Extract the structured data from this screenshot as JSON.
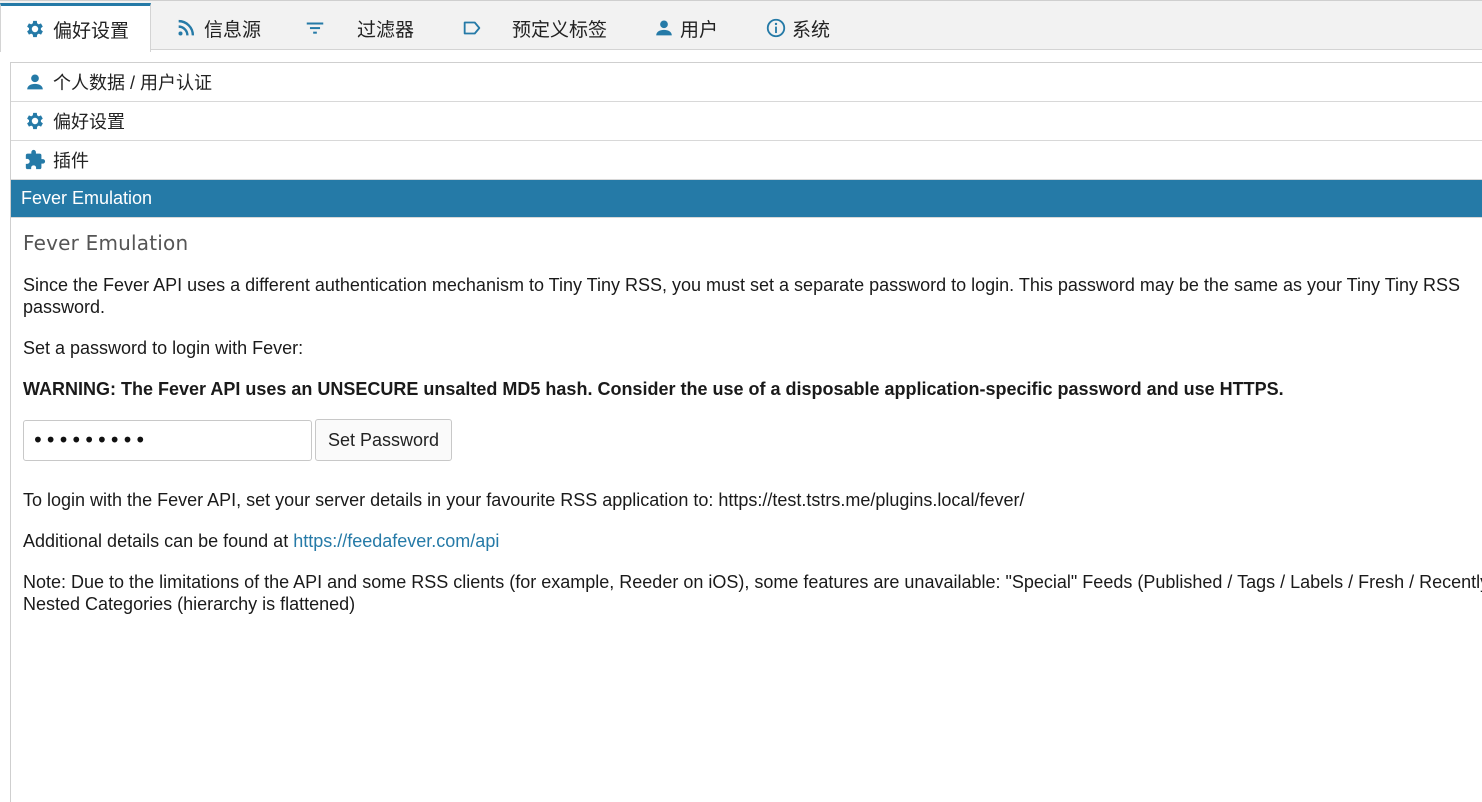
{
  "tabs": [
    {
      "label": "偏好设置",
      "icon": "gear-icon",
      "active": true
    },
    {
      "label": "信息源",
      "icon": "rss-icon",
      "active": false
    },
    {
      "label": "过滤器",
      "icon": "filter-icon",
      "active": false
    },
    {
      "label": "预定义标签",
      "icon": "label-icon",
      "active": false
    },
    {
      "label": "用户",
      "icon": "user-icon",
      "active": false
    },
    {
      "label": "系统",
      "icon": "info-icon",
      "active": false
    }
  ],
  "sections": [
    {
      "label": "个人数据 / 用户认证",
      "icon": "user-icon"
    },
    {
      "label": "偏好设置",
      "icon": "gear-icon"
    },
    {
      "label": "插件",
      "icon": "puzzle-icon"
    },
    {
      "label": "Fever Emulation",
      "icon": "",
      "active": true
    }
  ],
  "fever": {
    "heading": "Fever Emulation",
    "intro_line1": "Since the Fever API uses a different authentication mechanism to Tiny Tiny RSS, you must set a separate password to login. This password may be the same as your Tiny Tiny RSS",
    "intro_line2": "password.",
    "set_prompt": "Set a password to login with Fever:",
    "warning": "WARNING: The Fever API uses an UNSECURE unsalted MD5 hash. Consider the use of a disposable application-specific password and use HTTPS.",
    "password_value": "•••••••••",
    "set_button": "Set Password",
    "login_info": "To login with the Fever API, set your server details in your favourite RSS application to: https://test.tstrs.me/plugins.local/fever/",
    "details_prefix": "Additional details can be found at ",
    "details_link": "https://feedafever.com/api",
    "note_line1": "Note: Due to the limitations of the API and some RSS clients (for example, Reeder on iOS), some features are unavailable: \"Special\" Feeds (Published / Tags / Labels / Fresh / Recently Read)",
    "note_line2": "Nested Categories (hierarchy is flattened)"
  },
  "colors": {
    "accent": "#257aa7",
    "topbar": "#f2f2f2"
  }
}
